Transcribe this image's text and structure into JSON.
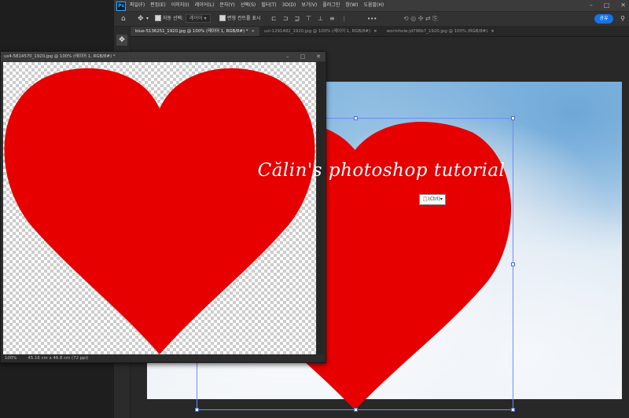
{
  "app": {
    "logo": "Ps",
    "menu": [
      "파일(F)",
      "편집(E)",
      "이미지(I)",
      "레이어(L)",
      "문자(Y)",
      "선택(S)",
      "필터(T)",
      "3D(D)",
      "보기(V)",
      "플러그인",
      "창(W)",
      "도움말(H)"
    ],
    "window_controls": [
      "–",
      "□",
      "✕"
    ]
  },
  "options_bar": {
    "auto_select_label": "자동 선택:",
    "auto_select_value": "레이어",
    "show_transform_label": "변형 컨트롤 표시",
    "more": "•••",
    "share_label": "공유",
    "search_icon": "magnifier-icon"
  },
  "tabs": [
    {
      "label": "blue-5136251_1920.jpg @ 100% (레이어 1, RGB/8#) *",
      "active": true
    },
    {
      "label": "usl-1291482_1920.jpg @ 100% (레이어 1, RGB/8#)",
      "active": false
    },
    {
      "label": "wormhole-jd796b7_1920.jpg @ 100% (RGB/8#)",
      "active": false
    }
  ],
  "floating_window": {
    "title": "us4-5814570_1920.jpg @ 100% (레이어 1, RGB/8#) *",
    "controls": [
      "–",
      "□",
      "✕"
    ],
    "status_zoom": "100%",
    "status_dims": "45.16 cm x 46.8 cm (72 ppi)"
  },
  "paste_badge": {
    "label": "(Ctrl)",
    "arrow": "▾"
  },
  "watermark": "Călin's photoshop tutorial",
  "colors": {
    "heart": "#e60000",
    "accent": "#1473e6",
    "transform": "#6d8cff"
  }
}
